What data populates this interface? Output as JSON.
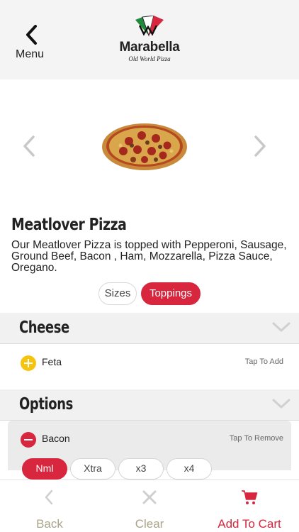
{
  "header": {
    "menu_label": "Menu",
    "logo_name": "Marabella",
    "logo_tagline": "Old World Pizza"
  },
  "product": {
    "title": "Meatlover Pizza",
    "description": "Our Meatlover Pizza is topped with Pepperoni, Sausage, Ground Beef, Bacon , Ham, Mozzarella, Pizza Sauce, Oregano."
  },
  "segments": {
    "sizes": "Sizes",
    "toppings": "Toppings",
    "selected": "Toppings"
  },
  "sections": [
    {
      "title": "Cheese",
      "items": [
        {
          "label": "Feta",
          "action": "Tap To Add",
          "state": "add"
        }
      ]
    },
    {
      "title": "Options",
      "items": [
        {
          "label": "Bacon",
          "action": "Tap To Remove",
          "state": "remove"
        }
      ]
    }
  ],
  "quantity_options": [
    "Nml",
    "Xtra",
    "x3",
    "x4"
  ],
  "quantity_selected": "Nml",
  "bottom_bar": {
    "back": "Back",
    "clear": "Clear",
    "add_to_cart": "Add To Cart"
  },
  "colors": {
    "accent": "#d7263d",
    "add_icon": "#f6c40f",
    "muted": "#a9a48a",
    "header_bg": "#f4f4f4"
  },
  "icons": {
    "menu": "chevron-left-icon",
    "carousel_prev": "chevron-left-icon",
    "carousel_next": "chevron-right-icon",
    "section_toggle": "chevron-down-icon",
    "add": "plus-circle-icon",
    "remove": "minus-circle-icon",
    "back": "chevron-left-icon",
    "clear": "close-icon",
    "cart": "cart-icon"
  }
}
